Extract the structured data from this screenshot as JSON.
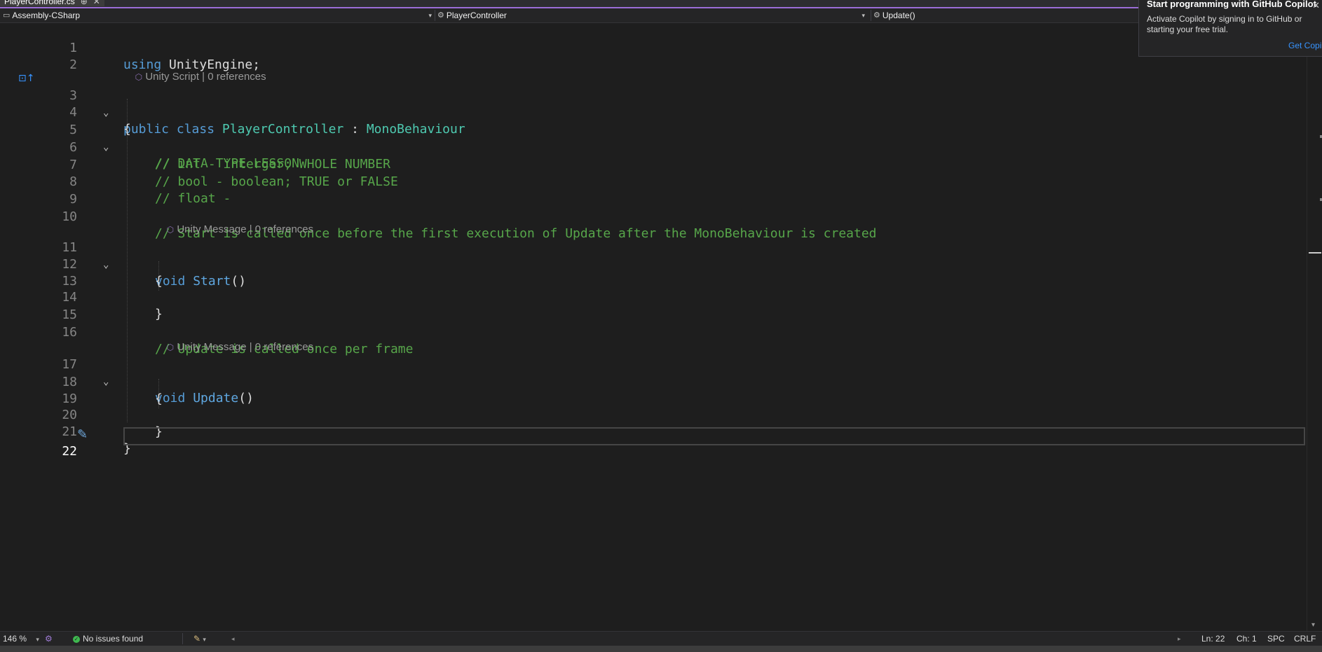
{
  "tab": {
    "title": "PlayerController.cs",
    "pin": "⊕",
    "close": "✕"
  },
  "navbar": {
    "project": "Assembly-CSharp",
    "class": "PlayerController",
    "member": "Update()"
  },
  "code_lines": [
    {
      "n": "1"
    },
    {
      "n": "2"
    },
    {
      "n": "3"
    },
    {
      "n": "4"
    },
    {
      "n": "5"
    },
    {
      "n": "6"
    },
    {
      "n": "7"
    },
    {
      "n": "8"
    },
    {
      "n": "9"
    },
    {
      "n": "10"
    },
    {
      "n": "11"
    },
    {
      "n": "12"
    },
    {
      "n": "13"
    },
    {
      "n": "14"
    },
    {
      "n": "15"
    },
    {
      "n": "16"
    },
    {
      "n": "17"
    },
    {
      "n": "18"
    },
    {
      "n": "19"
    },
    {
      "n": "20"
    },
    {
      "n": "21"
    },
    {
      "n": "22"
    }
  ],
  "code": {
    "using_kw": "using",
    "using_ns": " UnityEngine;",
    "public_kw": "public",
    "class_kw": "class",
    "class_name": "PlayerController",
    "colon": " : ",
    "base_class": "MonoBehaviour",
    "open_brace": "{",
    "close_brace": "}",
    "comment_1": "// DATA TYPE LESSON",
    "comment_2": "// int - interger; WHOLE NUMBER",
    "comment_3": "// bool - boolean; TRUE or FALSE",
    "comment_4": "// float -",
    "comment_5": "// Start is called once before the first execution of Update after the MonoBehaviour is created",
    "void_kw": "void",
    "start_name": "Start",
    "parens": "()",
    "comment_6": "// Update is called once per frame",
    "update_name": "Update"
  },
  "codelens": {
    "class_lens": "Unity Script | 0 references",
    "start_lens": "Unity Message | 0 references",
    "update_lens": "Unity Message | 0 references"
  },
  "copilot_popup": {
    "title": "Start programming with GitHub Copilot",
    "body": "Activate Copilot by signing in to GitHub or starting your free trial.",
    "link": "Get Copilot",
    "close": "✕"
  },
  "statusbar": {
    "zoom": "146 %",
    "issues": "No issues found",
    "position_line": "Ln: 22",
    "position_char": "Ch: 1",
    "whitespace": "SPC",
    "line_ending": "CRLF"
  },
  "icons": {
    "check": "✓",
    "dropdown": "▾",
    "cube": "⬡",
    "fold": "⌄",
    "brush": "✎"
  }
}
